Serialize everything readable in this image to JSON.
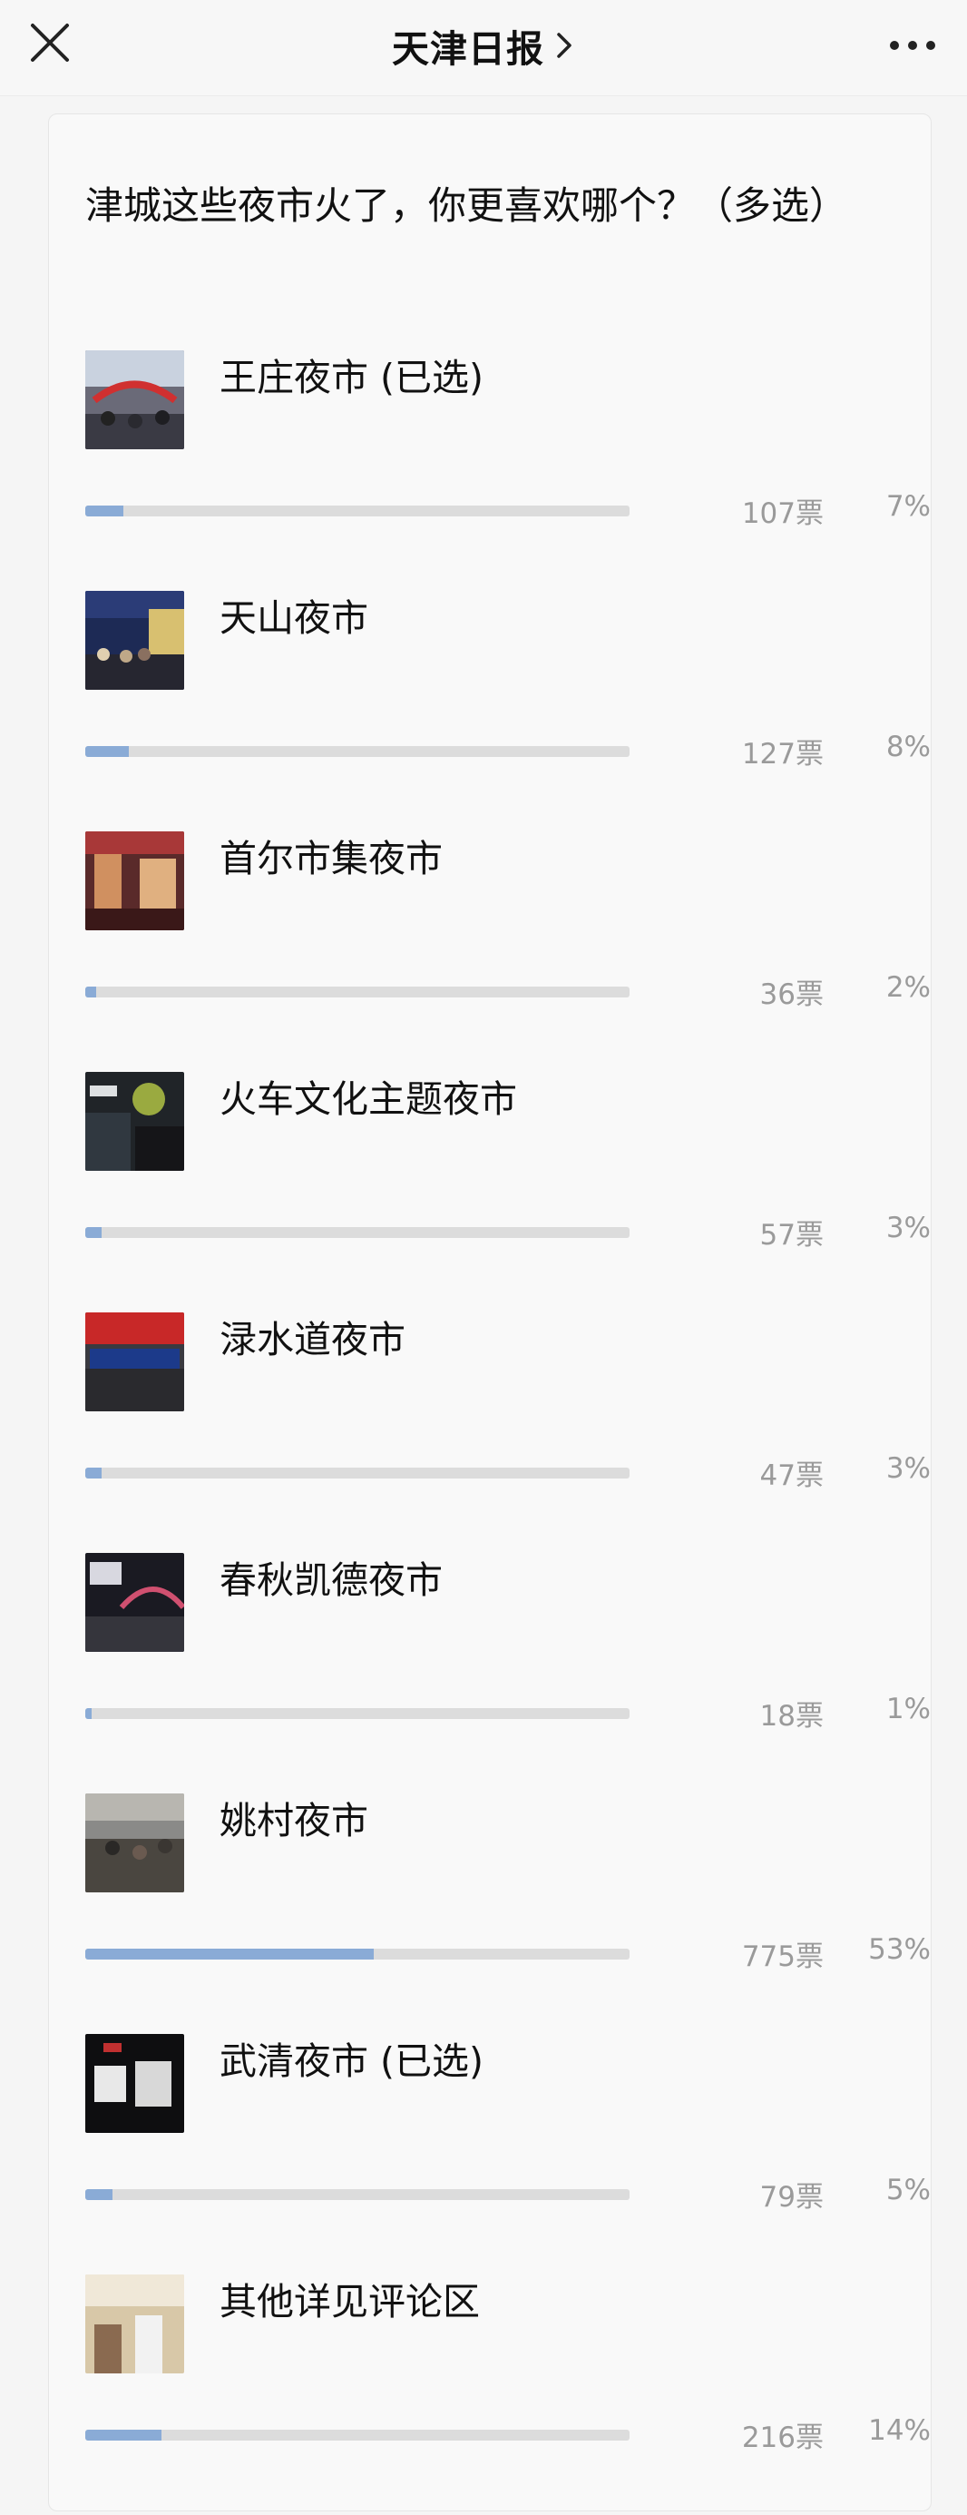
{
  "header": {
    "title": "天津日报"
  },
  "poll": {
    "question": "津城这些夜市火了，你更喜欢哪个？（多选）",
    "options": [
      {
        "label": "王庄夜市 (已选)",
        "votes": "107票",
        "percent": "7%",
        "ratio": 0.07
      },
      {
        "label": "天山夜市",
        "votes": "127票",
        "percent": "8%",
        "ratio": 0.08
      },
      {
        "label": "首尔市集夜市",
        "votes": "36票",
        "percent": "2%",
        "ratio": 0.02
      },
      {
        "label": "火车文化主题夜市",
        "votes": "57票",
        "percent": "3%",
        "ratio": 0.03
      },
      {
        "label": "渌水道夜市",
        "votes": "47票",
        "percent": "3%",
        "ratio": 0.03
      },
      {
        "label": "春秋凯德夜市",
        "votes": "18票",
        "percent": "1%",
        "ratio": 0.01
      },
      {
        "label": "姚村夜市",
        "votes": "775票",
        "percent": "53%",
        "ratio": 0.53
      },
      {
        "label": "武清夜市 (已选)",
        "votes": "79票",
        "percent": "5%",
        "ratio": 0.05
      },
      {
        "label": "其他详见评论区",
        "votes": "216票",
        "percent": "14%",
        "ratio": 0.14
      }
    ]
  },
  "colors": {
    "bar_fill": "#8aabd6",
    "bar_track": "#dcdcdc"
  }
}
